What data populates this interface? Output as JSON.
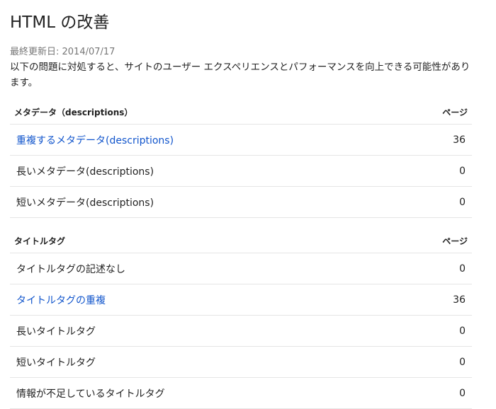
{
  "page": {
    "title": "HTML の改善",
    "updated": "最終更新日: 2014/07/17",
    "description": "以下の問題に対処すると、サイトのユーザー エクスペリエンスとパフォーマンスを向上できる可能性があります。"
  },
  "sections": [
    {
      "header": "メタデータ（descriptions）",
      "count_header": "ページ",
      "rows": [
        {
          "label": "重複するメタデータ(descriptions)",
          "count": "36",
          "link": true
        },
        {
          "label": "長いメタデータ(descriptions)",
          "count": "0",
          "link": false
        },
        {
          "label": "短いメタデータ(descriptions)",
          "count": "0",
          "link": false
        }
      ]
    },
    {
      "header": "タイトルタグ",
      "count_header": "ページ",
      "rows": [
        {
          "label": "タイトルタグの記述なし",
          "count": "0",
          "link": false
        },
        {
          "label": "タイトルタグの重複",
          "count": "36",
          "link": true
        },
        {
          "label": "長いタイトルタグ",
          "count": "0",
          "link": false
        },
        {
          "label": "短いタイトルタグ",
          "count": "0",
          "link": false
        },
        {
          "label": "情報が不足しているタイトルタグ",
          "count": "0",
          "link": false
        }
      ]
    }
  ],
  "colors": {
    "link": "#1155cc",
    "text": "#222222",
    "muted": "#777777",
    "divider": "#e5e5e5"
  }
}
